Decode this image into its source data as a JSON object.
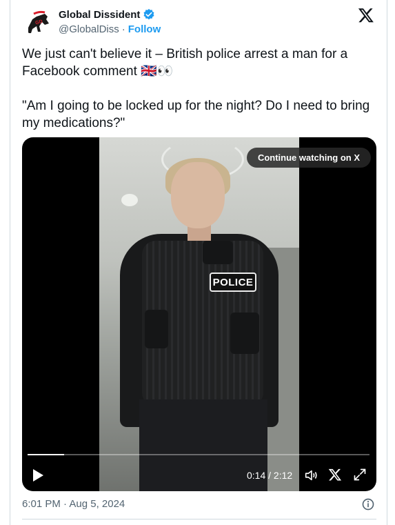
{
  "author": {
    "name": "Global Dissident",
    "handle": "@GlobalDiss",
    "separator": "·",
    "follow_label": "Follow",
    "verified": true,
    "avatar_icon": "horse-logo-avatar"
  },
  "tweet": {
    "text": "We just can't believe it – British police arrest a man for a Facebook comment 🇬🇧👀\n\n\"Am I going to be locked up for the night? Do I need to bring my medications?\""
  },
  "media": {
    "continue_label": "Continue watching on X",
    "badge_text": "POLICE",
    "current_time": "0:14",
    "duration": "2:12",
    "time_display": "0:14 / 2:12",
    "progress_fraction": 0.106
  },
  "footer": {
    "timestamp": "6:01 PM · Aug 5, 2024"
  },
  "colors": {
    "accent": "#1d9bf0",
    "muted": "#536471",
    "border": "#cfd9de",
    "text": "#0f1419"
  }
}
